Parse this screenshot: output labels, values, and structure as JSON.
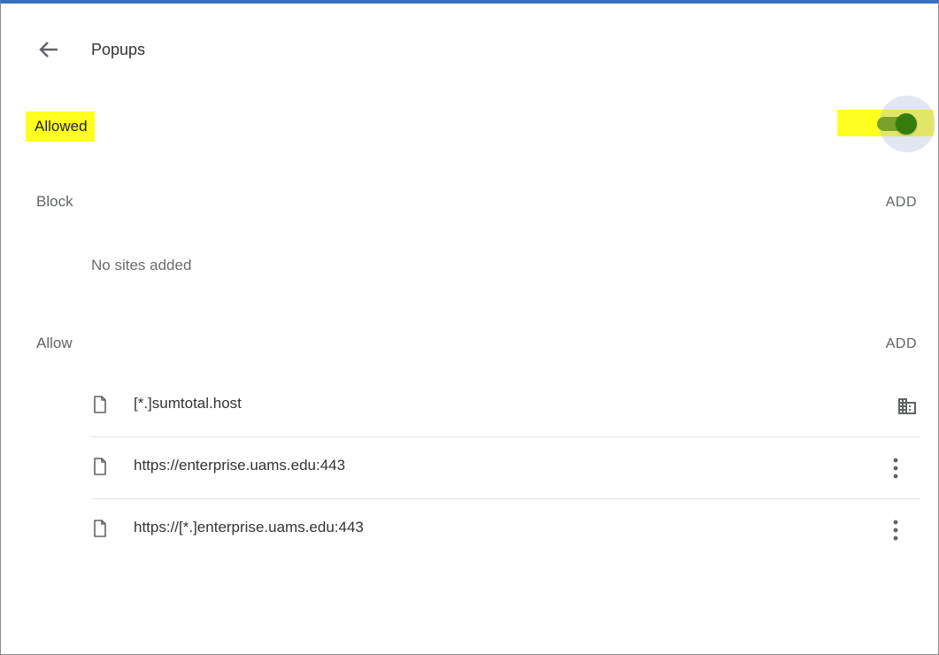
{
  "header": {
    "title": "Popups"
  },
  "main_toggle": {
    "label": "Allowed",
    "state": "on",
    "accent_color": "#337d10",
    "highlight_color": "#ffff1f"
  },
  "block_section": {
    "title": "Block",
    "add_label": "ADD",
    "empty_text": "No sites added"
  },
  "allow_section": {
    "title": "Allow",
    "add_label": "ADD",
    "sites": [
      {
        "url": "[*.]sumtotal.host",
        "icon": "file-icon",
        "action_icon": "enterprise-policy-icon"
      },
      {
        "url": "https://enterprise.uams.edu:443",
        "icon": "file-icon",
        "action_icon": "more-vert-icon"
      },
      {
        "url": "https://[*.]enterprise.uams.edu:443",
        "icon": "file-icon",
        "action_icon": "more-vert-icon"
      }
    ]
  }
}
